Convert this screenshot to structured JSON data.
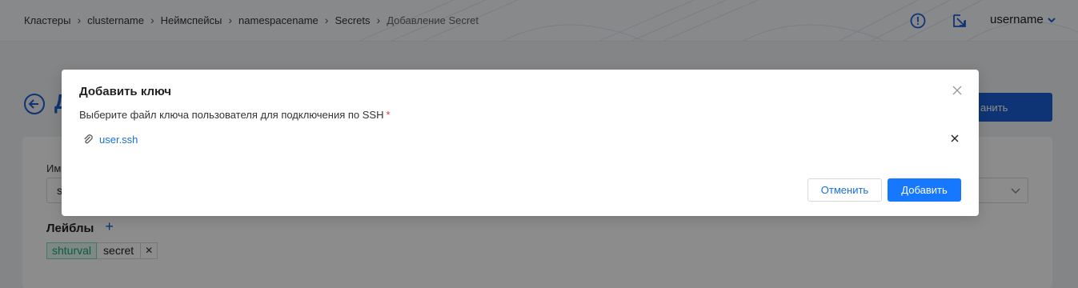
{
  "breadcrumbs": [
    "Кластеры",
    "clustername",
    "Неймспейсы",
    "namespacename",
    "Secrets",
    "Добавление Secret"
  ],
  "breadcrumb_separator": "›",
  "header": {
    "username": "username",
    "icons": [
      "alert-circle-icon",
      "external-link-icon",
      "chevron-down-icon"
    ]
  },
  "page": {
    "title_partial": "Д",
    "save_label_partial": "анить",
    "name_label_partial": "Им",
    "name_value_partial": "s",
    "labels_title": "Лейблы",
    "add_label_symbol": "+",
    "tag": {
      "key": "shturval",
      "value": "secret",
      "remove_symbol": "✕"
    }
  },
  "modal": {
    "title": "Добавить ключ",
    "prompt": "Выберите файл ключа пользователя для подключения по SSH",
    "required_mark": "*",
    "file_name": "user.ssh",
    "cancel_label": "Отменить",
    "add_label": "Добавить"
  },
  "colors": {
    "primary": "#1677ff",
    "link": "#1a6fd6",
    "required": "#e53935",
    "tag_green": "#17a679",
    "overlay": "rgba(0,0,0,0.45)"
  }
}
